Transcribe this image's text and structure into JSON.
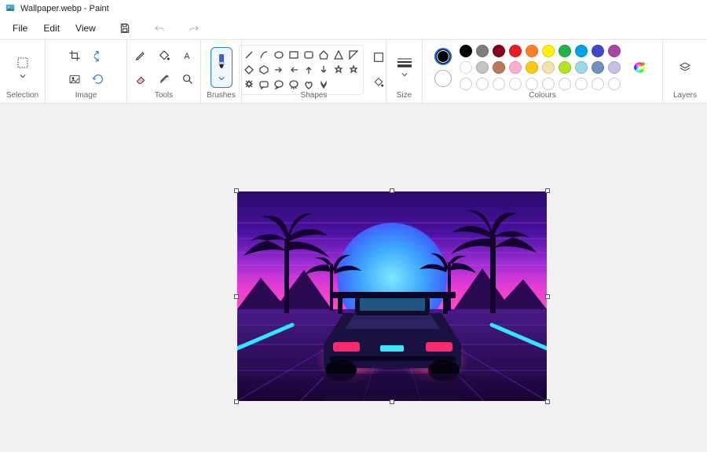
{
  "title": "Wallpaper.webp - Paint",
  "menu": {
    "file": "File",
    "edit": "Edit",
    "view": "View"
  },
  "ribbon": {
    "selection": "Selection",
    "image": "Image",
    "tools": "Tools",
    "brushes": "Brushes",
    "shapes": "Shapes",
    "size": "Size",
    "colours": "Colours",
    "layers": "Layers"
  },
  "colours": {
    "primary": "#000000",
    "secondary": "#ffffff",
    "palette_row1": [
      "#000000",
      "#7f7f7f",
      "#880015",
      "#ed1c24",
      "#ff7f27",
      "#fff200",
      "#22b14c",
      "#00a2e8",
      "#3f48cc",
      "#a349a4"
    ],
    "palette_row2": [
      "#ffffff",
      "#c3c3c3",
      "#b97a57",
      "#ffaec9",
      "#ffc90e",
      "#efe4b0",
      "#b5e61d",
      "#99d9ea",
      "#7092be",
      "#c8bfe7"
    ]
  }
}
